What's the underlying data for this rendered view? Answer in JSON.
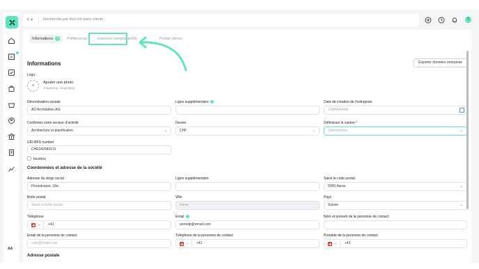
{
  "topbar": {
    "search_placeholder": "Recherche par mot-clé dans clients",
    "help": "?"
  },
  "sidebar": {
    "avatar_initials": "AA"
  },
  "tabs": [
    {
      "label": "Informations",
      "badge": "2"
    },
    {
      "label": "Préférences"
    },
    {
      "label": "Exercice comptable"
    },
    {
      "label": "IDE"
    },
    {
      "label": "Portail clients"
    }
  ],
  "section": {
    "title": "Informations",
    "export_label": "Exporter données entreprise"
  },
  "logo": {
    "label": "Logo",
    "add_photo": "Ajouter une photo",
    "types": "image/png, image/jpeg"
  },
  "fields": {
    "denomination": {
      "label": "Dénomination sociale",
      "value": "AD Architekten AG"
    },
    "ligne_sup": {
      "label": "Ligne supplémentaire",
      "value": ""
    },
    "date_creation": {
      "label": "Date de création de l'entreprise",
      "placeholder": "JJ/MM/AAAA"
    },
    "secteur": {
      "label": "Confirmez votre secteur d'activité",
      "value": "Architecture et planification"
    },
    "devise": {
      "label": "Devise",
      "value": "CHF"
    },
    "canton": {
      "label": "Définissez le canton *",
      "placeholder": "Sélectionnez"
    },
    "uid": {
      "label": "UID-BFS number",
      "value": "CHE342580131"
    },
    "inconnu": {
      "label": "Inconnu"
    }
  },
  "address": {
    "title": "Coordonnées et adresse de la société",
    "siege": {
      "label": "Adresse du siège social",
      "value": "Florastrasse, 18a"
    },
    "ligne_sup": {
      "label": "Ligne supplémentaire",
      "value": ""
    },
    "code_postal": {
      "label": "Saisir le code postal",
      "value": "5000 Aarau"
    },
    "boite": {
      "label": "Boîte postal",
      "placeholder": "Saisir la boîte postal"
    },
    "ville": {
      "label": "Ville",
      "value": "Aarau"
    },
    "pays": {
      "label": "Pays",
      "value": "Suisse"
    },
    "telephone": {
      "label": "Téléphone",
      "value": "+41"
    },
    "email": {
      "label": "Email",
      "value": "annedp@email.com"
    },
    "contact_nom": {
      "label": "Nom et prénom de la personne de contact",
      "value": ""
    },
    "contact_email": {
      "label": "Email de la personne de contact",
      "placeholder": "nom@email.com"
    },
    "contact_tel": {
      "label": "Téléphone de la personne de contact",
      "value": "+41"
    },
    "contact_portable": {
      "label": "Portable de la personne de contact",
      "value": "+41"
    }
  },
  "postal": {
    "title": "Adresse postale"
  },
  "icons": [
    "search-icon",
    "add-circle-icon",
    "clock-icon",
    "bell-icon",
    "home-icon",
    "clients-icon",
    "tasks-icon",
    "bag-icon",
    "basket-icon",
    "user-icon",
    "bank-icon",
    "document-icon",
    "chart-icon"
  ],
  "colors": {
    "accent": "#5fe3c0",
    "bg": "#f4f5f7"
  }
}
